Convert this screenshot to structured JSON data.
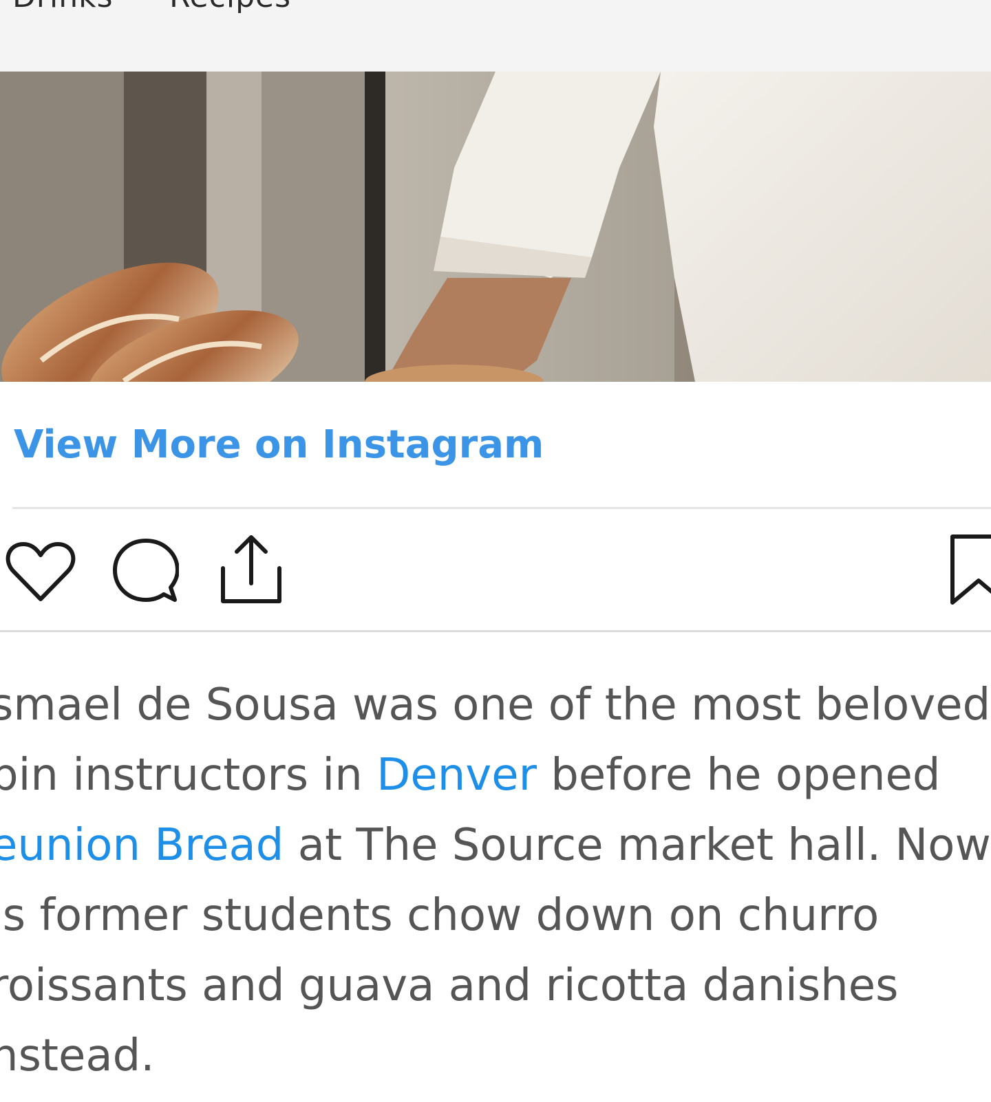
{
  "topnav": {
    "items": [
      "Drinks",
      "Recipes"
    ]
  },
  "photo": {
    "description": "baker-with-bread-photo"
  },
  "embed": {
    "view_more_label": "View More on Instagram"
  },
  "actions": {
    "like_icon": "heart-icon",
    "comment_icon": "comment-icon",
    "share_icon": "share-icon",
    "save_icon": "bookmark-icon"
  },
  "caption": {
    "line1": "smael de Sousa was one of the most beloved",
    "line2_a": "pin instructors in ",
    "line2_link": "Denver",
    "line2_b": " before he opened",
    "line3_link": "eunion Bread",
    "line3_b": " at The Source market hall. Now",
    "line4": "is former students chow down on churro",
    "line5": "roissants and guava and ricotta danishes",
    "line6": "nstead."
  },
  "colors": {
    "link": "#1e8fe8",
    "instagram_link": "#3b94e6",
    "body_text": "#555555",
    "nav_bg": "#f4f4f4"
  }
}
